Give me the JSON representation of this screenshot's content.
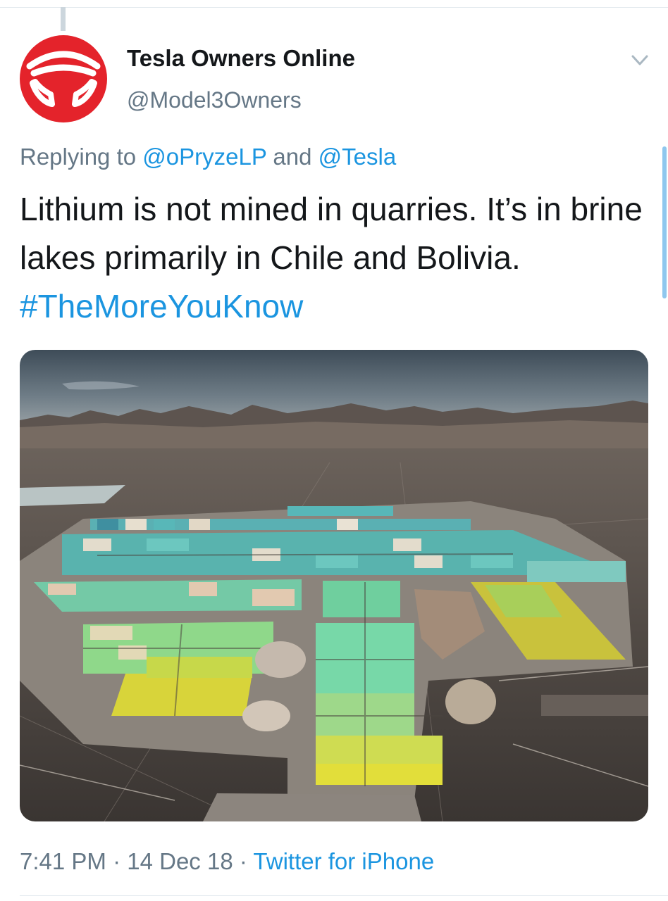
{
  "tweet": {
    "author_name": "Tesla Owners Online",
    "author_handle": "@Model3Owners",
    "avatar_icon": "steering-wheel-icon",
    "menu_icon": "chevron-down-icon",
    "replying_prefix": "Replying to ",
    "reply_to_1": "@oPryzeLP",
    "reply_and": " and ",
    "reply_to_2": "@Tesla",
    "text": "Lithium is not mined in quarries. It’s in brine lakes primarily in Chile and Bolivia. ",
    "hashtag": "#TheMoreYouKnow",
    "time": "7:41 PM",
    "separator": " · ",
    "date": "14 Dec 18",
    "source": "Twitter for iPhone"
  },
  "colors": {
    "avatar_red": "#e4232b",
    "link_blue": "#1b95e0",
    "secondary_gray": "#657786",
    "text_black": "#14171a"
  }
}
